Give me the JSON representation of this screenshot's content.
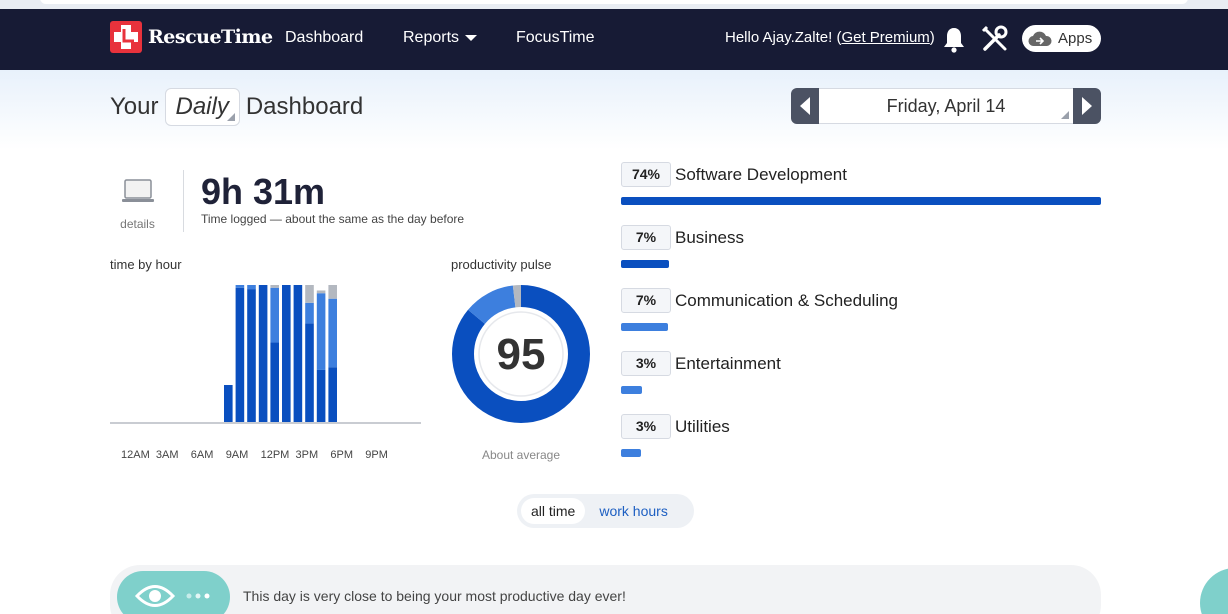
{
  "nav": {
    "brand": "RescueTime",
    "links": [
      "Dashboard",
      "Reports",
      "FocusTime"
    ],
    "greeting": "Hello Ajay.Zalte! (",
    "premium_link": "Get Premium",
    "greeting_end": ")",
    "apps_label": "Apps"
  },
  "header": {
    "title_prefix": "Your",
    "period": "Daily",
    "title_suffix": "Dashboard",
    "date": "Friday, April 14"
  },
  "summary": {
    "details_label": "details",
    "time_logged": "9h 31m",
    "time_caption": "Time logged — about the same as the day before"
  },
  "hour_chart": {
    "title": "time by hour",
    "ticks": [
      "12AM",
      "3AM",
      "6AM",
      "9AM",
      "12PM",
      "3PM",
      "6PM",
      "9PM"
    ],
    "colors": {
      "very_productive": "#0a4fbf",
      "productive": "#3d7fde",
      "neutral": "#b3b8c0"
    }
  },
  "pulse": {
    "title": "productivity pulse",
    "score": "95",
    "caption": "About average",
    "segments": [
      {
        "name": "very_productive",
        "fraction": 0.86,
        "color": "#0a4fbf"
      },
      {
        "name": "productive",
        "fraction": 0.12,
        "color": "#3d7fde"
      },
      {
        "name": "neutral",
        "fraction": 0.02,
        "color": "#b3b8c0"
      }
    ]
  },
  "categories": [
    {
      "pct": "74%",
      "name": "Software Development",
      "fraction": 1.0,
      "color": "#0a4fbf"
    },
    {
      "pct": "7%",
      "name": "Business",
      "fraction": 0.1,
      "color": "#0a4fbf"
    },
    {
      "pct": "7%",
      "name": "Communication & Scheduling",
      "fraction": 0.098,
      "color": "#3d7fde"
    },
    {
      "pct": "3%",
      "name": "Entertainment",
      "fraction": 0.044,
      "color": "#3d7fde"
    },
    {
      "pct": "3%",
      "name": "Utilities",
      "fraction": 0.042,
      "color": "#3d7fde"
    }
  ],
  "toggle": {
    "all_time": "all time",
    "work_hours": "work hours"
  },
  "banner": {
    "text": "This day is very close to being your most productive day ever!"
  },
  "chart_data": {
    "type": "bar",
    "title": "time by hour",
    "x_ticks": [
      "12AM",
      "3AM",
      "6AM",
      "9AM",
      "12PM",
      "3PM",
      "6PM",
      "9PM"
    ],
    "categories": [
      "8AM",
      "9AM",
      "10AM",
      "11AM",
      "12PM",
      "1PM",
      "2PM",
      "3PM",
      "4PM",
      "5PM"
    ],
    "series": [
      {
        "name": "very productive",
        "values": [
          0.27,
          0.98,
          0.97,
          1.0,
          0.58,
          1.0,
          1.0,
          0.72,
          0.38,
          0.4
        ]
      },
      {
        "name": "productive",
        "values": [
          0.0,
          0.02,
          0.03,
          0.0,
          0.4,
          0.0,
          0.0,
          0.15,
          0.56,
          0.5
        ]
      },
      {
        "name": "neutral",
        "values": [
          0.0,
          0.0,
          0.0,
          0.0,
          0.02,
          0.0,
          0.0,
          0.13,
          0.02,
          0.1
        ]
      }
    ],
    "ylim": [
      0,
      1
    ]
  }
}
